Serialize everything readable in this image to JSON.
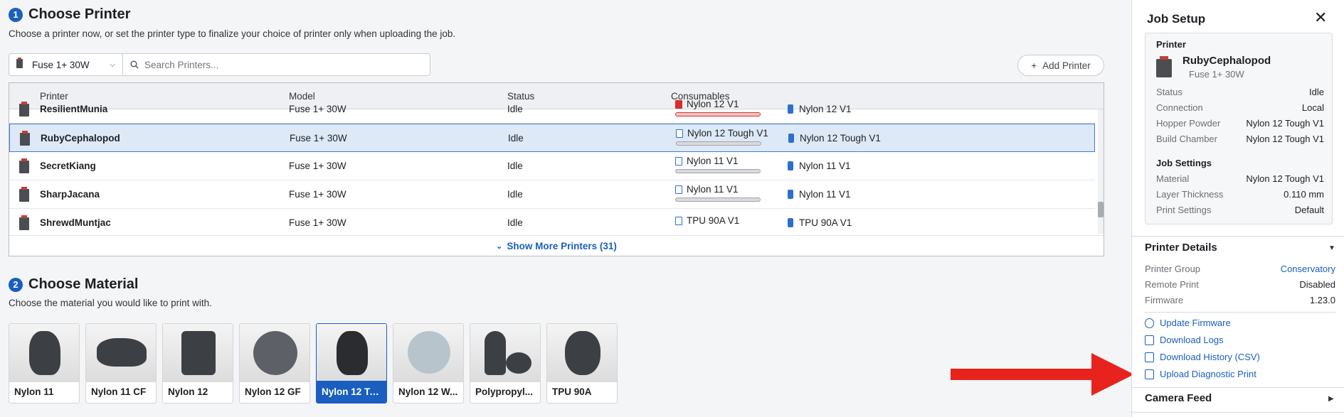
{
  "section1": {
    "step": "1",
    "title": "Choose Printer",
    "subtitle": "Choose a printer now, or set the printer type to finalize your choice of printer only when uploading the job."
  },
  "filter": {
    "printer_type": "Fuse 1+ 30W",
    "search_placeholder": "Search Printers..."
  },
  "add_printer_label": "Add Printer",
  "table": {
    "headers": [
      "Printer",
      "Model",
      "Status",
      "Consumables"
    ],
    "rows": [
      {
        "name": "ResilientMunia",
        "model": "Fuse 1+ 30W",
        "status": "Idle",
        "cons1": "Nylon 12 V1",
        "cons2": "Nylon 12 V1",
        "low": true
      },
      {
        "name": "RubyCephalopod",
        "model": "Fuse 1+ 30W",
        "status": "Idle",
        "cons1": "Nylon 12 Tough V1",
        "cons2": "Nylon 12 Tough V1",
        "selected": true
      },
      {
        "name": "SecretKiang",
        "model": "Fuse 1+ 30W",
        "status": "Idle",
        "cons1": "Nylon 11 V1",
        "cons2": "Nylon 11 V1"
      },
      {
        "name": "SharpJacana",
        "model": "Fuse 1+ 30W",
        "status": "Idle",
        "cons1": "Nylon 11 V1",
        "cons2": "Nylon 11 V1"
      },
      {
        "name": "ShrewdMuntjac",
        "model": "Fuse 1+ 30W",
        "status": "Idle",
        "cons1": "TPU 90A V1",
        "cons2": "TPU 90A V1"
      }
    ],
    "show_more": "Show More Printers (31)"
  },
  "section2": {
    "step": "2",
    "title": "Choose Material",
    "subtitle": "Choose the material you would like to print with."
  },
  "materials": [
    "Nylon 11",
    "Nylon 11 CF",
    "Nylon 12",
    "Nylon 12 GF",
    "Nylon 12 To...",
    "Nylon 12 W...",
    "Polypropyl...",
    "TPU 90A"
  ],
  "selected_material_index": 4,
  "panel": {
    "title": "Job Setup",
    "printer_heading": "Printer",
    "printer_name": "RubyCephalopod",
    "printer_model": "Fuse 1+ 30W",
    "printer_kv": [
      {
        "k": "Status",
        "v": "Idle"
      },
      {
        "k": "Connection",
        "v": "Local"
      },
      {
        "k": "Hopper Powder",
        "v": "Nylon 12 Tough V1"
      },
      {
        "k": "Build Chamber",
        "v": "Nylon 12 Tough V1"
      }
    ],
    "job_settings_heading": "Job Settings",
    "job_kv": [
      {
        "k": "Material",
        "v": "Nylon 12 Tough V1"
      },
      {
        "k": "Layer Thickness",
        "v": "0.110 mm"
      },
      {
        "k": "Print Settings",
        "v": "Default"
      }
    ],
    "printer_details_heading": "Printer Details",
    "details": [
      {
        "k": "Printer Group",
        "v": "Conservatory"
      },
      {
        "k": "Remote Print",
        "v": "Disabled"
      },
      {
        "k": "Firmware",
        "v": "1.23.0"
      }
    ],
    "actions": [
      "Update Firmware",
      "Download Logs",
      "Download History (CSV)",
      "Upload Diagnostic Print"
    ],
    "camera_heading": "Camera Feed"
  },
  "colors": {
    "accent": "#1a5fbf",
    "arrow": "#e8231e",
    "low_consumable": "#d92d2d"
  }
}
